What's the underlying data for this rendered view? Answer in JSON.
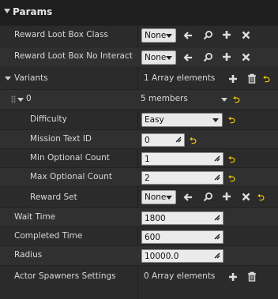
{
  "header": {
    "title": "Params"
  },
  "rows": {
    "reward_loot_box_class": {
      "label": "Reward Loot Box Class",
      "value": "None"
    },
    "reward_loot_box_no_interact": {
      "label": "Reward Loot Box No Interact Cl",
      "value": "None"
    },
    "variants": {
      "label": "Variants",
      "value": "1 Array elements"
    },
    "variant_0": {
      "label": "0",
      "value": "5 members"
    },
    "difficulty": {
      "label": "Difficulty",
      "value": "Easy"
    },
    "mission_text_id": {
      "label": "Mission Text ID",
      "value": "0"
    },
    "min_optional_count": {
      "label": "Min Optional Count",
      "value": "1"
    },
    "max_optional_count": {
      "label": "Max Optional Count",
      "value": "2"
    },
    "reward_set": {
      "label": "Reward Set",
      "value": "None"
    },
    "wait_time": {
      "label": "Wait Time",
      "value": "1800"
    },
    "completed_time": {
      "label": "Completed Time",
      "value": "600"
    },
    "radius": {
      "label": "Radius",
      "value": "10000.0"
    },
    "actor_spawners_settings": {
      "label": "Actor Spawners Settings",
      "value": "0 Array elements"
    }
  },
  "icons": {
    "use_selected": "arrow-left-icon",
    "browse": "search-icon",
    "add": "plus-icon",
    "clear": "close-icon",
    "remove_all": "trash-icon",
    "reset_to_default": "reset-arrow-icon",
    "resize_handle": "resize-icon"
  },
  "colors": {
    "background": "#2b2b2b",
    "header": "#1e1e1e",
    "reset_arrow": "#e8c10b",
    "field": "#ebebeb"
  }
}
